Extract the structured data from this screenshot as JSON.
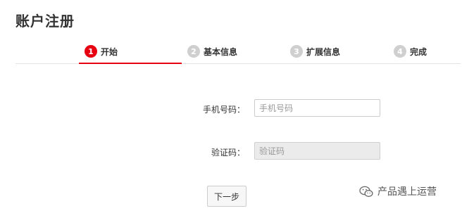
{
  "page": {
    "title": "账户注册"
  },
  "steps": [
    {
      "number": "1",
      "label": "开始",
      "active": true
    },
    {
      "number": "2",
      "label": "基本信息",
      "active": false
    },
    {
      "number": "3",
      "label": "扩展信息",
      "active": false
    },
    {
      "number": "4",
      "label": "完成",
      "active": false
    }
  ],
  "form": {
    "phone": {
      "label": "手机号码：",
      "placeholder": "手机号码",
      "value": ""
    },
    "code": {
      "label": "验证码：",
      "placeholder": "验证码",
      "value": ""
    },
    "next_label": "下一步"
  },
  "watermark": {
    "text": "产品遇上运营",
    "icon": "wechat-icon"
  },
  "colors": {
    "accent": "#e60012",
    "inactive_step": "#cfcfcf",
    "divider": "#e3e3e3"
  }
}
